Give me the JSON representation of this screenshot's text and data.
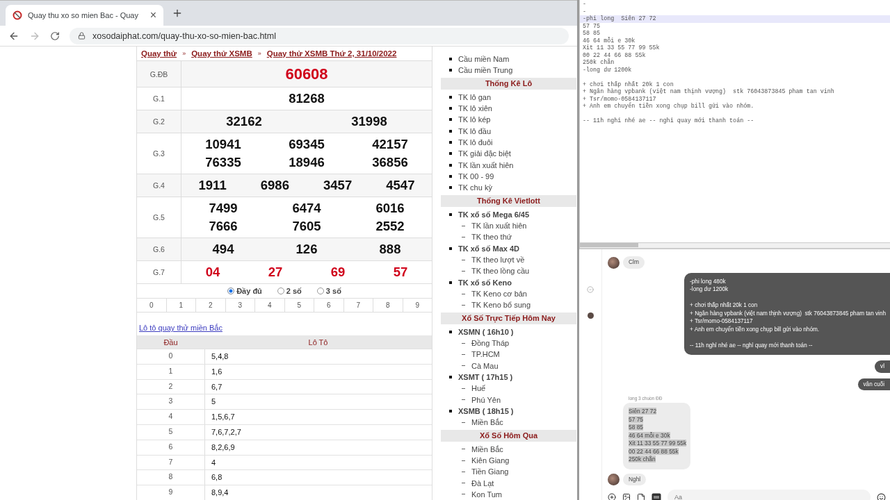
{
  "browser": {
    "tab": {
      "title": "Quay thu xo so mien Bac - Quay",
      "close": "×"
    },
    "url": "xosodaiphat.com/quay-thu-xo-so-mien-bac.html"
  },
  "breadcrumb": [
    {
      "kind": "link",
      "label": "Quay thử"
    },
    {
      "kind": "sep",
      "label": "»"
    },
    {
      "kind": "link",
      "label": "Quay thử XSMB"
    },
    {
      "kind": "sep",
      "label": "»"
    },
    {
      "kind": "link",
      "label": "Quay thử XSMB Thứ 2, 31/10/2022"
    }
  ],
  "results": [
    {
      "label": "G.ĐB",
      "red": true,
      "big": true,
      "lines": [
        [
          "60608"
        ]
      ]
    },
    {
      "label": "G.1",
      "red": false,
      "big": false,
      "lines": [
        [
          "81268"
        ]
      ]
    },
    {
      "label": "G.2",
      "red": false,
      "big": false,
      "lines": [
        [
          "32162",
          "31998"
        ]
      ]
    },
    {
      "label": "G.3",
      "red": false,
      "big": false,
      "lines": [
        [
          "10941",
          "69345",
          "42157"
        ],
        [
          "76335",
          "18946",
          "36856"
        ]
      ]
    },
    {
      "label": "G.4",
      "red": false,
      "big": false,
      "lines": [
        [
          "1911",
          "6986",
          "3457",
          "4547"
        ]
      ]
    },
    {
      "label": "G.5",
      "red": false,
      "big": false,
      "lines": [
        [
          "7499",
          "6474",
          "6016"
        ],
        [
          "7666",
          "7605",
          "2552"
        ]
      ]
    },
    {
      "label": "G.6",
      "red": false,
      "big": false,
      "lines": [
        [
          "494",
          "126",
          "888"
        ]
      ]
    },
    {
      "label": "G.7",
      "red": true,
      "big": false,
      "lines": [
        [
          "04",
          "27",
          "69",
          "57"
        ]
      ]
    }
  ],
  "display_options": [
    {
      "label": "Đầy đủ",
      "selected": true
    },
    {
      "label": "2 số",
      "selected": false
    },
    {
      "label": "3 số",
      "selected": false
    }
  ],
  "digits": [
    "0",
    "1",
    "2",
    "3",
    "4",
    "5",
    "6",
    "7",
    "8",
    "9"
  ],
  "loto_link": "Lô tô quay thử miền Bắc",
  "loto_table": {
    "columns": [
      "Đầu",
      "Lô Tô"
    ],
    "rows": [
      {
        "head": "0",
        "values": "5,4,8"
      },
      {
        "head": "1",
        "values": "1,6"
      },
      {
        "head": "2",
        "values": "6,7"
      },
      {
        "head": "3",
        "values": "5"
      },
      {
        "head": "4",
        "values": "1,5,6,7"
      },
      {
        "head": "5",
        "values": "7,6,7,2,7"
      },
      {
        "head": "6",
        "values": "8,2,6,9"
      },
      {
        "head": "7",
        "values": "4"
      },
      {
        "head": "8",
        "values": "6,8"
      },
      {
        "head": "9",
        "values": "8,9,4"
      }
    ]
  },
  "sidebar": [
    {
      "kind": "item",
      "label": "Cầu miền Nam"
    },
    {
      "kind": "item",
      "label": "Cầu miền Trung"
    },
    {
      "kind": "header",
      "label": "Thống Kê Lô"
    },
    {
      "kind": "item",
      "label": "TK lô gan"
    },
    {
      "kind": "item",
      "label": "TK lô xiên"
    },
    {
      "kind": "item",
      "label": "TK lô kép"
    },
    {
      "kind": "item",
      "label": "TK lô đầu"
    },
    {
      "kind": "item",
      "label": "TK lô đuôi"
    },
    {
      "kind": "item",
      "label": "TK giải đặc biệt"
    },
    {
      "kind": "item",
      "label": "TK lần xuất hiên"
    },
    {
      "kind": "item",
      "label": "TK 00 - 99"
    },
    {
      "kind": "item",
      "label": "TK chu kỳ"
    },
    {
      "kind": "header",
      "label": "Thống Kê Vietlott"
    },
    {
      "kind": "group",
      "label": "TK xổ số Mega 6/45",
      "children": [
        "TK lần xuất hiên",
        "TK theo thứ"
      ]
    },
    {
      "kind": "group",
      "label": "TK xổ số Max 4D",
      "children": [
        "TK theo lượt về",
        "TK theo lồng cầu"
      ]
    },
    {
      "kind": "group",
      "label": "TK xổ số Keno",
      "children": [
        "TK Keno cơ bản",
        "TK Keno bổ sung"
      ]
    },
    {
      "kind": "header",
      "label": "Xổ Số Trực Tiếp Hôm Nay"
    },
    {
      "kind": "group",
      "label": "XSMN ( 16h10 )",
      "children": [
        "Đồng Tháp",
        "TP.HCM",
        "Cà Mau"
      ]
    },
    {
      "kind": "group",
      "label": "XSMT ( 17h15 )",
      "children": [
        "Huế",
        "Phú Yên"
      ]
    },
    {
      "kind": "group",
      "label": "XSMB ( 18h15 )",
      "children": [
        "Miền Bắc"
      ]
    },
    {
      "kind": "header",
      "label": "Xổ Số Hôm Qua"
    },
    {
      "kind": "sub",
      "children": [
        "Miền Bắc",
        "Kiên Giang",
        "Tiền Giang",
        "Đà Lạt",
        "Kon Tum"
      ]
    }
  ],
  "notepad": {
    "blocks": [
      [
        {
          "text": "-",
          "current": false
        },
        {
          "text": "-",
          "current": false
        },
        {
          "text": "-phi long  Siên 27 72",
          "current": true
        },
        {
          "text": "57 75",
          "current": false
        },
        {
          "text": "58 85",
          "current": false
        },
        {
          "text": "46 64 mỗi e 30k",
          "current": false
        },
        {
          "text": "Xit 11 33 55 77 99 55k",
          "current": false
        },
        {
          "text": "00 22 44 66 88 55k",
          "current": false
        },
        {
          "text": "250k chẵn",
          "current": false
        },
        {
          "text": "-long dư 1200k",
          "current": false
        }
      ],
      [
        {
          "text": "+ chơi thấp nhất 20k 1 con",
          "current": false
        },
        {
          "text": "+ Ngân hàng vpbank (việt nam thịnh vượng)  stk 76043873845 pham tan vinh",
          "current": false
        },
        {
          "text": "+ Tsr/momo-0584137117",
          "current": false
        },
        {
          "text": "+ Anh em chuyển tiền xong chụp bill gửi vào nhóm.",
          "current": false
        }
      ],
      [
        {
          "text": "-- 11h nghỉ nhé ae -- nghỉ quay mới thanh toán --",
          "current": false
        }
      ]
    ]
  },
  "chat": {
    "messages": [
      {
        "kind": "incoming",
        "avatar": true,
        "selected": false,
        "text": "Clm"
      },
      {
        "kind": "outgoing",
        "selected": false,
        "text": "-phi long 480k\n-long dư 1200k\n\n+ chơi thấp nhất 20k 1 con\n+ Ngân hàng vpbank (việt nam thịnh vượng)  stk 76043873845 pham tan vinh\n+ Tsr/momo-0584137117\n+ Anh em chuyển tiền xong chụp bill gửi vào nhóm.\n\n-- 11h nghỉ nhé ae -- nghỉ quay mới thanh toán --"
      },
      {
        "kind": "outgoing",
        "selected": false,
        "text": "vl"
      },
      {
        "kind": "outgoing",
        "selected": false,
        "text": "vân cuối"
      },
      {
        "kind": "incoming",
        "avatar": false,
        "selected": true,
        "sender": "long 3 chuồn ĐĐ",
        "text": "Siên 27 72\n57 75\n58 85\n46 64 mỗi e 30k\nXit 11 33 55 77 99 55k\n00 22 44 66 88 55k\n250k chẵn"
      },
      {
        "kind": "incoming",
        "avatar": true,
        "selected": false,
        "text": "Nghỉ"
      }
    ],
    "input": {
      "placeholder": "Aa"
    }
  }
}
